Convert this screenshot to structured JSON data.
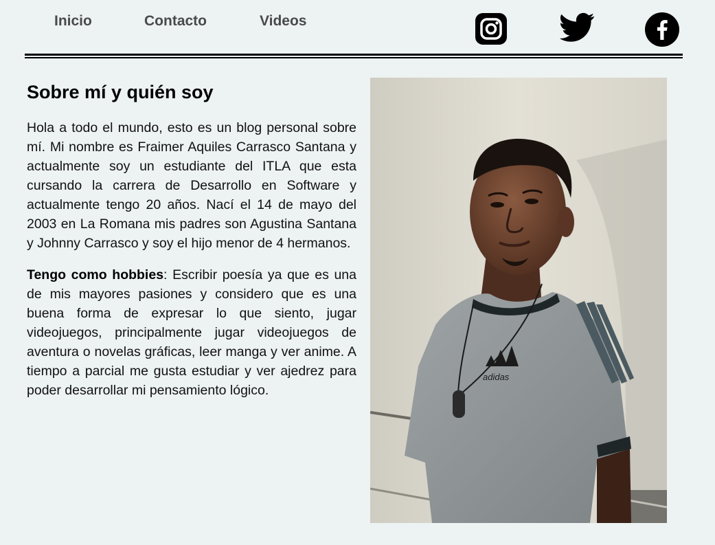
{
  "nav": {
    "items": [
      {
        "label": "Inicio"
      },
      {
        "label": "Contacto"
      },
      {
        "label": "Videos"
      }
    ]
  },
  "social": {
    "icons": [
      "instagram-icon",
      "twitter-icon",
      "facebook-icon"
    ]
  },
  "about": {
    "title": "Sobre mí y quién soy",
    "paragraph1": "Hola a todo el mundo, esto es un blog personal sobre mí. Mi nombre es Fraimer Aquiles Carrasco Santana y actualmente soy un estudiante del ITLA que esta cursando la carrera de Desarrollo en Software y actualmente tengo 20 años. Nací el 14 de mayo del 2003 en La Romana mis padres son Agustina Santana y Johnny Carrasco y soy el hijo menor de 4 hermanos.",
    "hobbies_label": "Tengo como hobbies",
    "paragraph2": ": Escribir poesía ya que es una de mis mayores pasiones y considero que es una buena forma de expresar lo que siento, jugar videojuegos, principalmente jugar videojuegos de aventura o novelas gráficas, leer manga y ver anime. A tiempo a parcial me gusta estudiar y ver ajedrez para poder desarrollar mi pensamiento lógico."
  },
  "photo": {
    "shirt_logo_text": "adidas"
  },
  "colors": {
    "background": "#edf2f2",
    "nav_text": "#4a4a4a",
    "rule": "#000000"
  }
}
